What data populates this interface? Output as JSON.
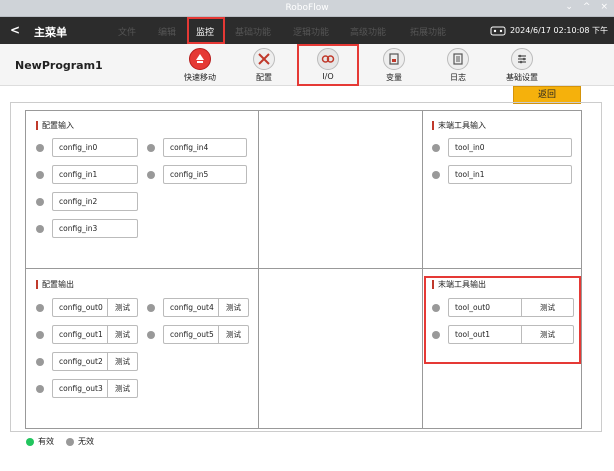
{
  "window": {
    "title": "RoboFlow",
    "buttons": [
      "⌄",
      "^",
      "×"
    ]
  },
  "menubar": {
    "back": "<",
    "main_menu": "主菜单",
    "items": [
      {
        "label": "文件",
        "active": false
      },
      {
        "label": "编辑",
        "active": false
      },
      {
        "label": "监控",
        "active": true
      },
      {
        "label": "基础功能",
        "active": false
      },
      {
        "label": "逻辑功能",
        "active": false
      },
      {
        "label": "高级功能",
        "active": false
      },
      {
        "label": "拓展功能",
        "active": false
      }
    ],
    "datetime": "2024/6/17 02:10:08 下午"
  },
  "toolbar": {
    "program_name": "NewProgram1",
    "buttons": [
      {
        "label": "快速移动",
        "icon": "quick-move-icon"
      },
      {
        "label": "配置",
        "icon": "tools-icon"
      },
      {
        "label": "I/O",
        "icon": "io-icon",
        "selected": true
      },
      {
        "label": "变量",
        "icon": "variable-icon"
      },
      {
        "label": "日志",
        "icon": "log-icon"
      },
      {
        "label": "基础设置",
        "icon": "settings-icon"
      }
    ],
    "return_label": "返回"
  },
  "sections": {
    "config_in": {
      "title": "配置输入",
      "items": [
        "config_in0",
        "config_in1",
        "config_in2",
        "config_in3",
        "config_in4",
        "config_in5"
      ]
    },
    "tool_in": {
      "title": "末端工具输入",
      "items": [
        "tool_in0",
        "tool_in1"
      ]
    },
    "config_out": {
      "title": "配置输出",
      "items": [
        "config_out0",
        "config_out1",
        "config_out2",
        "config_out3",
        "config_out4",
        "config_out5"
      ]
    },
    "tool_out": {
      "title": "末端工具输出",
      "items": [
        "tool_out0",
        "tool_out1"
      ]
    }
  },
  "test_label": "测试",
  "legend": {
    "valid": "有效",
    "invalid": "无效"
  },
  "colors": {
    "valid": "#22c55e",
    "invalid": "#999999",
    "highlight": "#e53935",
    "return": "#f5b10c"
  }
}
